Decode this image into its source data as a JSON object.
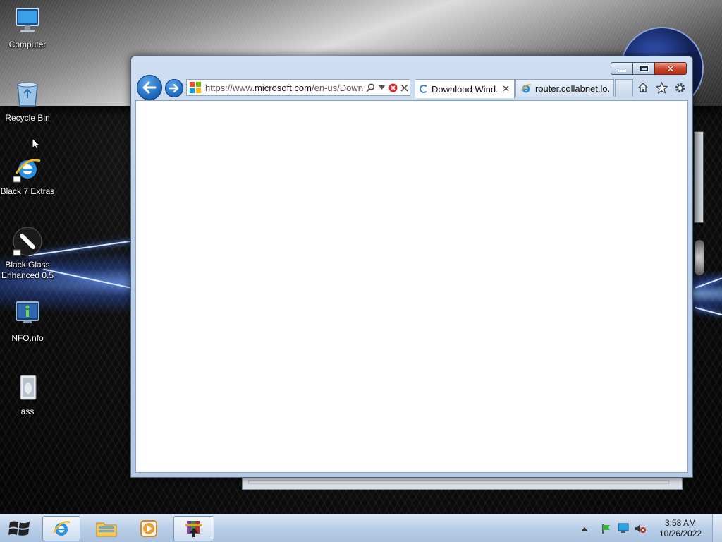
{
  "desktop": {
    "icons": [
      {
        "label": "Computer",
        "icon": "computer-icon"
      },
      {
        "label": "Recycle Bin",
        "icon": "recycle-bin-icon"
      },
      {
        "label": "Black 7 Extras",
        "icon": "internet-explorer-icon"
      },
      {
        "label": "Black Glass Enhanced 0.5",
        "icon": "brush-icon"
      },
      {
        "label": "NFO.nfo",
        "icon": "info-file-icon"
      },
      {
        "label": "ass",
        "icon": "folder-image-icon"
      }
    ]
  },
  "browser": {
    "address": {
      "url_prefix": "https://www.",
      "url_domain": "microsoft.com",
      "url_rest": "/en-us/Down"
    },
    "tabs": [
      {
        "label": "Download Wind...",
        "state": "loading"
      },
      {
        "label": "router.collabnet.lo...",
        "state": "idle"
      }
    ],
    "command_icons": [
      "home-icon",
      "favorites-star-icon",
      "tools-gear-icon"
    ],
    "caption_buttons": {
      "close_glyph": "✕"
    }
  },
  "taskbar": {
    "pinned": [
      {
        "name": "internet-explorer",
        "active": true
      },
      {
        "name": "windows-explorer",
        "active": false
      },
      {
        "name": "media-player",
        "active": false
      },
      {
        "name": "winrar",
        "active": true
      }
    ],
    "clock": {
      "time": "3:58 AM",
      "date": "10/26/2022"
    }
  },
  "colors": {
    "accent": "#1a64b8",
    "taskbar": "#bcd0e8",
    "close_red": "#c9452b"
  }
}
